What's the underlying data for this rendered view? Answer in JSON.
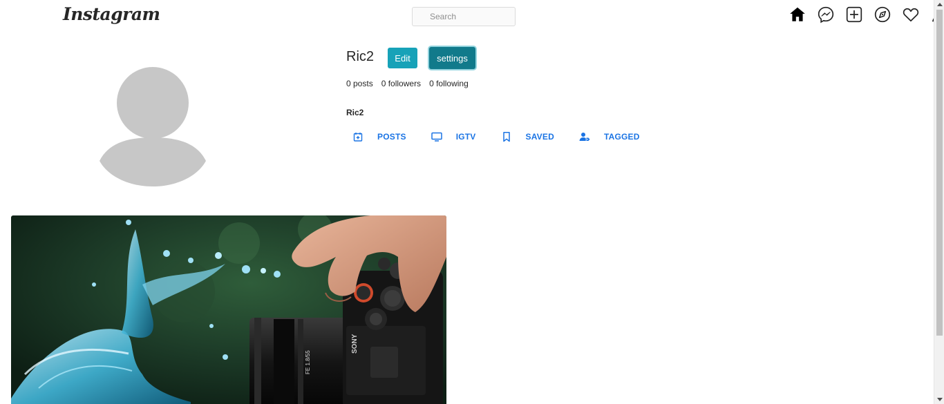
{
  "header": {
    "logo": "Instagram",
    "search": {
      "placeholder": "Search",
      "value": ""
    },
    "icons": [
      "home-icon",
      "messenger-icon",
      "new-post-icon",
      "explore-icon",
      "activity-heart-icon",
      "profile-icon"
    ]
  },
  "profile": {
    "username": "Ric2",
    "edit_label": "Edit",
    "settings_label": "settings",
    "stats": {
      "posts": "0 posts",
      "followers": "0 followers",
      "following": "0 following"
    },
    "display_name": "Ric2"
  },
  "tabs": [
    {
      "label": "POSTS",
      "icon": "calendar-icon"
    },
    {
      "label": "IGTV",
      "icon": "tv-icon"
    },
    {
      "label": "SAVED",
      "icon": "bookmark-icon"
    },
    {
      "label": "TAGGED",
      "icon": "tag-user-icon"
    }
  ],
  "colors": {
    "edit_button": "#17a2b8",
    "settings_button": "#117a8b",
    "tab_text": "#1b74e4",
    "avatar": "#c7c7c7"
  }
}
